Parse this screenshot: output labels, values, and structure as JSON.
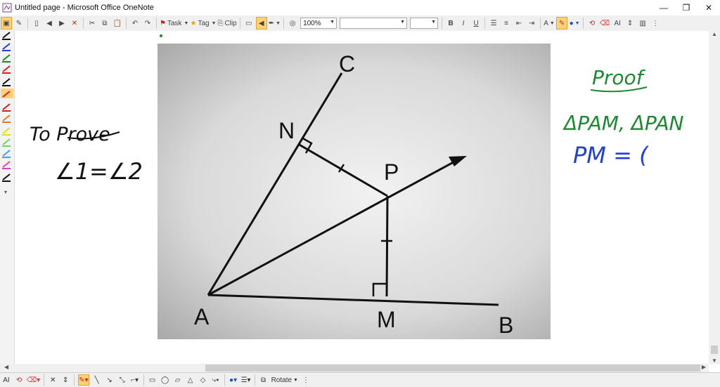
{
  "window": {
    "title": "Untitled page - Microsoft Office OneNote"
  },
  "toolbar": {
    "task_label": "Task",
    "tag_label": "Tag",
    "clip_label": "Clip",
    "zoom_value": "100%",
    "font_value": "",
    "size_value": "",
    "bold_label": "B",
    "italic_label": "I",
    "underline_label": "U"
  },
  "bottombar": {
    "rotate_label": "Rotate"
  },
  "figure": {
    "labels": {
      "c": "C",
      "n": "N",
      "p": "P",
      "a": "A",
      "m": "M",
      "b": "B"
    }
  },
  "notes": {
    "to_prove": "To Prove",
    "angle_eq": "∠1=∠2",
    "proof": "Proof",
    "triangles": "ΔPAM, ΔPAN",
    "pm_eq": "PM = ("
  },
  "colors": {
    "green_ink": "#1a8a2e",
    "blue_ink": "#1f3fd6",
    "black_ink": "#111111",
    "highlight": "#ffd27a"
  }
}
